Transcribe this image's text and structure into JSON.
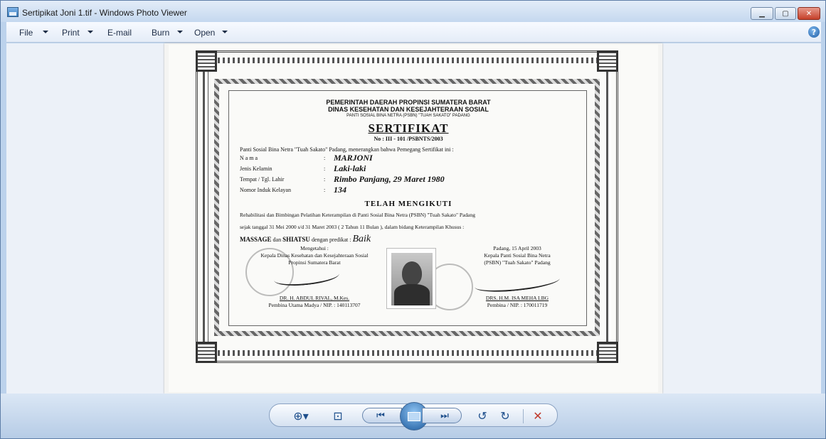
{
  "window": {
    "title": "Sertipikat Joni 1.tif - Windows Photo Viewer",
    "minimize": "▁",
    "maximize": "▢",
    "close": "✕"
  },
  "menu": {
    "items": [
      {
        "label": "File"
      },
      {
        "label": "Print"
      },
      {
        "label": "E-mail"
      },
      {
        "label": "Burn"
      },
      {
        "label": "Open"
      }
    ],
    "help": "?"
  },
  "certificate": {
    "header1": "PEMERINTAH DAERAH PROPINSI SUMATERA BARAT",
    "header2": "DINAS KESEHATAN DAN KESEJAHTERAAN SOSIAL",
    "header3": "PANTI SOSIAL BINA NETRA (PSBN) \"TUAH SAKATO\" PADANG",
    "title": "SERTIFIKAT",
    "number": "No : III - 101 /PSBNTS/2003",
    "intro": "Panti Sosial Bina Netra \"Tuah Sakato\" Padang, menerangkan bahwa Pemegang Sertifikat ini :",
    "fields": [
      {
        "label": "N a m a",
        "colon": ":",
        "value": "MARJONI"
      },
      {
        "label": "Jenis Kelamin",
        "colon": ":",
        "value": "Laki-laki"
      },
      {
        "label": "Tempat / Tgl. Lahir",
        "colon": ":",
        "value": "Rimbo Panjang,  29 Maret 1980"
      },
      {
        "label": "Nomor Induk Kelayan",
        "colon": ":",
        "value": "134"
      }
    ],
    "telah": "TELAH  MENGIKUTI",
    "para1": "Rehabilitasi dan Bimbingan Pelatihan Keterampilan di Panti Sosial Bina Netra (PSBN) \"Tuah Sakato\" Padang",
    "para2": "sejak tanggal  31 Mei 2000  s/d  31 Maret 2003 ( 2 Tahun  11 Bulan ), dalam bidang Keterampilan Khusus  :",
    "massage_b1": "MASSAGE",
    "massage_dan": " dan ",
    "massage_b2": "SHIATSU",
    "massage_pred": " dengan predikat  :  ",
    "massage_val": "Baik",
    "left_sig": {
      "l1": "Mengetahui :",
      "l2": "Kepala Dinas Kesehatan dan Kesejahteraan Sosial",
      "l3": "Propinsi Sumatera Barat",
      "name": "DR. H. ABDUL RIVAL, M.Kes.",
      "nip": "Pembina Utama Madya / NIP. :  140113707"
    },
    "right_sig": {
      "l1": "Padang,  15 April 2003",
      "l2": "Kepala Panti Sosial Bina Netra",
      "l3": "(PSBN) \"Tuah Sakato\" Padang",
      "name": "DRS. H.M. ISA MEHA LBG",
      "nip": "Pembina  / NIP. :  170011719"
    }
  },
  "controls": {
    "zoom": "⊕▾",
    "fit": "⊡",
    "prev": "⏮",
    "next": "⏭",
    "rotate_ccw": "↺",
    "rotate_cw": "↻",
    "delete": "✕"
  }
}
